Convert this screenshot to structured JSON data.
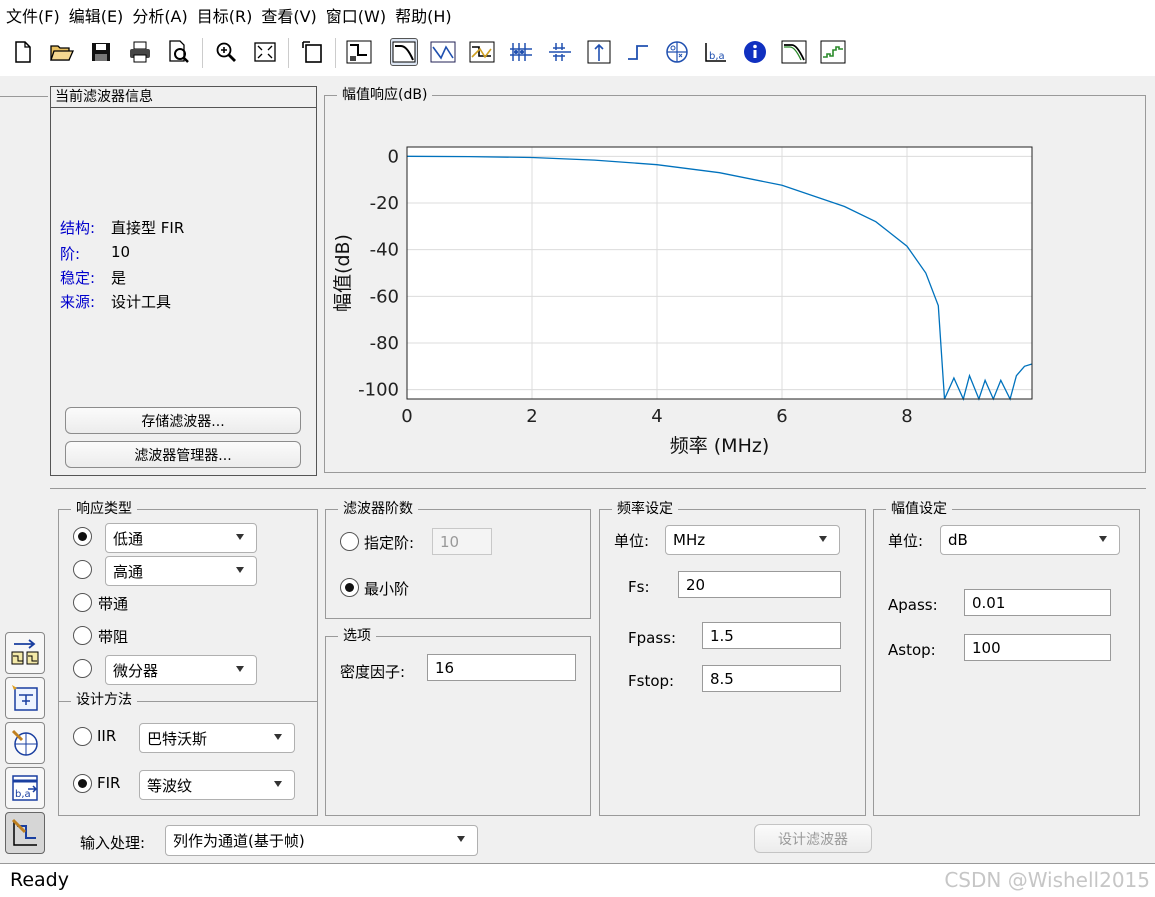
{
  "menu": [
    "文件(F)",
    "编辑(E)",
    "分析(A)",
    "目标(R)",
    "查看(V)",
    "窗口(W)",
    "帮助(H)"
  ],
  "toolbar_icons": [
    "new-file-icon",
    "open-folder-icon",
    "save-icon",
    "print-icon",
    "print-preview-icon",
    "zoom-in-icon",
    "full-view-icon",
    "new-figure-icon",
    "filter-spec-icon",
    "magnitude-response-icon",
    "phase-response-icon",
    "magnitude-phase-icon",
    "group-delay-icon",
    "phase-delay-icon",
    "impulse-response-icon",
    "step-response-icon",
    "pole-zero-icon",
    "coefficients-icon",
    "info-icon",
    "magnitude-estimate-icon",
    "noise-psd-icon"
  ],
  "filter_info": {
    "title": "当前滤波器信息",
    "rows": [
      {
        "key": "结构:",
        "value": "直接型 FIR"
      },
      {
        "key": "阶:",
        "value": "10"
      },
      {
        "key": "稳定:",
        "value": "是"
      },
      {
        "key": "来源:",
        "value": "设计工具"
      }
    ],
    "store_button": "存储滤波器...",
    "manager_button": "滤波器管理器..."
  },
  "plot": {
    "panel_title": "幅值响应(dB)",
    "chart_data": {
      "type": "line",
      "title": "",
      "xlabel": "频率 (MHz)",
      "ylabel": "幅值(dB)",
      "xlim": [
        0,
        10
      ],
      "ylim": [
        -104,
        4
      ],
      "xticks": [
        "0",
        "2",
        "4",
        "6",
        "8"
      ],
      "yticks": [
        "0",
        "-20",
        "-40",
        "-60",
        "-80",
        "-100"
      ],
      "grid": true,
      "series": [
        {
          "x": [
            0,
            1,
            2,
            3,
            4,
            5,
            6,
            7,
            7.5,
            8,
            8.3,
            8.5,
            8.6,
            8.75,
            8.9,
            9.0,
            9.15,
            9.25,
            9.38,
            9.5,
            9.65,
            9.75,
            9.88,
            10
          ],
          "y": [
            0,
            -0.1,
            -0.5,
            -1.6,
            -3.6,
            -7,
            -12.4,
            -21.5,
            -28,
            -38.5,
            -50,
            -64,
            -104,
            -95,
            -104,
            -94,
            -104,
            -96,
            -104,
            -96,
            -104,
            -94,
            -90,
            -89
          ]
        }
      ]
    }
  },
  "response_type": {
    "title": "响应类型",
    "lowpass": "低通",
    "highpass": "高通",
    "bandpass": "带通",
    "bandstop": "带阻",
    "differentiator": "微分器"
  },
  "design_method": {
    "title": "设计方法",
    "iir": "IIR",
    "iir_value": "巴特沃斯",
    "fir": "FIR",
    "fir_value": "等波纹"
  },
  "filter_order": {
    "title": "滤波器阶数",
    "specify": "指定阶:",
    "specify_value": "10",
    "minimum": "最小阶"
  },
  "options": {
    "title": "选项",
    "density_label": "密度因子:",
    "density_value": "16"
  },
  "freq_spec": {
    "title": "频率设定",
    "unit_label": "单位:",
    "unit_value": "MHz",
    "fs_label": "Fs:",
    "fs_value": "20",
    "fpass_label": "Fpass:",
    "fpass_value": "1.5",
    "fstop_label": "Fstop:",
    "fstop_value": "8.5"
  },
  "mag_spec": {
    "title": "幅值设定",
    "unit_label": "单位:",
    "unit_value": "dB",
    "apass_label": "Apass:",
    "apass_value": "0.01",
    "astop_label": "Astop:",
    "astop_value": "100"
  },
  "input_processing": {
    "label": "输入处理:",
    "value": "列作为通道(基于帧)"
  },
  "design_button": "设计滤波器",
  "status": "Ready",
  "watermark": "CSDN @Wishell2015",
  "colors": {
    "line": "#0072bd",
    "axis_label_blue": "#0000cc"
  }
}
